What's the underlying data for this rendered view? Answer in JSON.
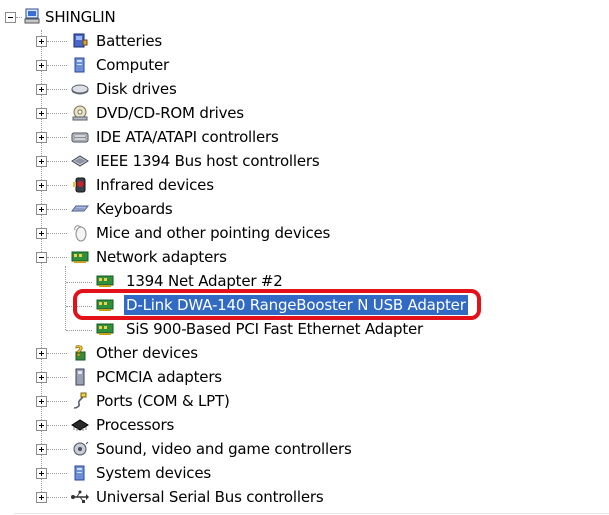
{
  "root": {
    "label": "SHINGLIN",
    "icon": "computer-icon",
    "expanded": true
  },
  "categories": [
    {
      "label": "Batteries",
      "icon": "battery-icon",
      "expanded": false
    },
    {
      "label": "Computer",
      "icon": "computer-icon",
      "expanded": false
    },
    {
      "label": "Disk drives",
      "icon": "disk-drive-icon",
      "expanded": false
    },
    {
      "label": "DVD/CD-ROM drives",
      "icon": "cdrom-icon",
      "expanded": false
    },
    {
      "label": "IDE ATA/ATAPI controllers",
      "icon": "ide-controller-icon",
      "expanded": false
    },
    {
      "label": "IEEE 1394 Bus host controllers",
      "icon": "firewire-icon",
      "expanded": false
    },
    {
      "label": "Infrared devices",
      "icon": "infrared-icon",
      "expanded": false
    },
    {
      "label": "Keyboards",
      "icon": "keyboard-icon",
      "expanded": false
    },
    {
      "label": "Mice and other pointing devices",
      "icon": "mouse-icon",
      "expanded": false
    },
    {
      "label": "Network adapters",
      "icon": "network-adapter-icon",
      "expanded": true,
      "children": [
        {
          "label": "1394 Net Adapter #2",
          "icon": "network-card-icon",
          "selected": false
        },
        {
          "label": "D-Link DWA-140 RangeBooster N USB Adapter",
          "icon": "network-card-icon",
          "selected": true
        },
        {
          "label": "SiS 900-Based PCI Fast Ethernet Adapter",
          "icon": "network-card-icon",
          "selected": false
        }
      ]
    },
    {
      "label": "Other devices",
      "icon": "unknown-device-icon",
      "expanded": false
    },
    {
      "label": "PCMCIA adapters",
      "icon": "pcmcia-icon",
      "expanded": false
    },
    {
      "label": "Ports (COM & LPT)",
      "icon": "port-icon",
      "expanded": false
    },
    {
      "label": "Processors",
      "icon": "processor-icon",
      "expanded": false
    },
    {
      "label": "Sound, video and game controllers",
      "icon": "sound-icon",
      "expanded": false
    },
    {
      "label": "System devices",
      "icon": "system-device-icon",
      "expanded": false
    },
    {
      "label": "Universal Serial Bus controllers",
      "icon": "usb-icon",
      "expanded": false
    }
  ],
  "colors": {
    "selection": "#316ac5",
    "annotation_ring": "#e3121a"
  }
}
